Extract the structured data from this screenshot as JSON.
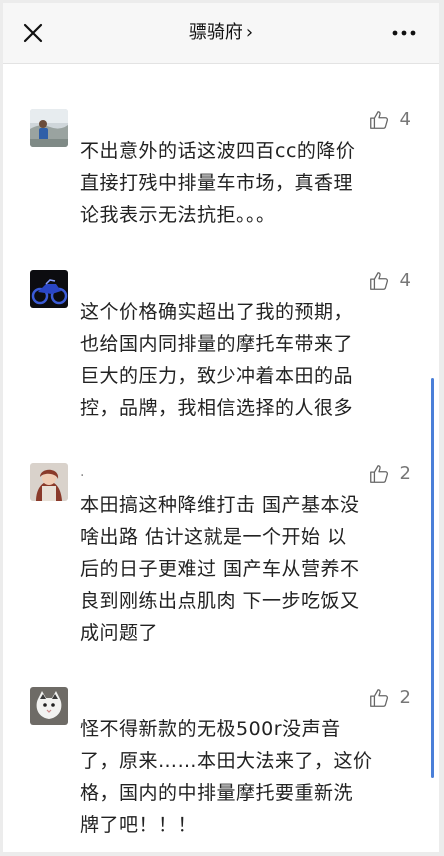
{
  "header": {
    "title": "骠骑府",
    "chevron": "›",
    "close_icon": "close-icon",
    "more_icon": "more-icon"
  },
  "comments": [
    {
      "nickname": "",
      "likes": "4",
      "text": "不出意外的话这波四百cc的降价\n直接打残中排量车市场，真香理\n论我表示无法抗拒。。。"
    },
    {
      "nickname": "",
      "likes": "4",
      "text": "这个价格确实超出了我的预期，\n也给国内同排量的摩托车带来了\n巨大的压力，致少冲着本田的品\n控，品牌，我相信选择的人很多"
    },
    {
      "nickname": ".",
      "likes": "2",
      "text": "本田搞这种降维打击 国产基本没\n啥出路 估计这就是一个开始 以\n后的日子更难过 国产车从营养不\n良到刚练出点肌肉 下一步吃饭又\n成问题了"
    },
    {
      "nickname": "",
      "likes": "2",
      "text": "怪不得新款的无极500r没声音\n了，原来……本田大法来了，这价\n格，国内的中排量摩托要重新洗\n牌了吧！！！"
    }
  ],
  "colors": {
    "header_bg": "#f7f7f7",
    "text": "#222222",
    "like_icon": "#666666",
    "scrollbar": "#4a7fd8"
  }
}
